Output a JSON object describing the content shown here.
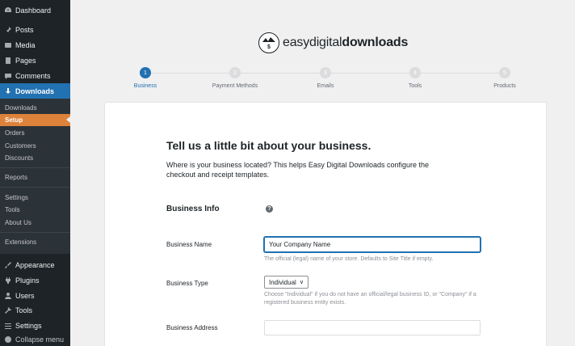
{
  "sidebar": {
    "top_items": [
      {
        "label": "Dashboard",
        "icon": "dashboard-icon"
      },
      {
        "label": "Posts",
        "icon": "pin-icon"
      },
      {
        "label": "Media",
        "icon": "media-icon"
      },
      {
        "label": "Pages",
        "icon": "pages-icon"
      },
      {
        "label": "Comments",
        "icon": "comment-icon"
      },
      {
        "label": "Downloads",
        "icon": "download-icon"
      }
    ],
    "sub_items": [
      "Downloads",
      "Setup",
      "Orders",
      "Customers",
      "Discounts",
      "Reports",
      "Settings",
      "Tools",
      "About Us",
      "Extensions"
    ],
    "bottom_items": [
      {
        "label": "Appearance",
        "icon": "brush-icon"
      },
      {
        "label": "Plugins",
        "icon": "plug-icon"
      },
      {
        "label": "Users",
        "icon": "user-icon"
      },
      {
        "label": "Tools",
        "icon": "wrench-icon"
      },
      {
        "label": "Settings",
        "icon": "settings-icon"
      },
      {
        "label": "Collapse menu",
        "icon": "collapse-icon"
      }
    ]
  },
  "logo": {
    "part1": "easy",
    "part2": "digital",
    "part3": "downloads"
  },
  "steps": [
    {
      "num": "1",
      "label": "Business"
    },
    {
      "num": "2",
      "label": "Payment Methods"
    },
    {
      "num": "3",
      "label": "Emails"
    },
    {
      "num": "4",
      "label": "Tools"
    },
    {
      "num": "5",
      "label": "Products"
    }
  ],
  "form": {
    "heading": "Tell us a little bit about your business.",
    "intro": "Where is your business located? This helps Easy Digital Downloads configure the checkout and receipt templates.",
    "section_title": "Business Info",
    "help": "?",
    "business_name_label": "Business Name",
    "business_name_value": "Your Company Name",
    "business_name_desc": "The official (legal) name of your store. Defaults to Site Title if empty.",
    "business_type_label": "Business Type",
    "business_type_value": "Individual",
    "business_type_desc": "Choose \"Individual\" if you do not have an official/legal business ID, or \"Company\" if a registered business entity exists.",
    "business_address_label": "Business Address",
    "business_address_value": ""
  },
  "colors": {
    "accent": "#2271b1",
    "setup_highlight": "#dd823b",
    "sidebar_bg": "#1d2327"
  }
}
